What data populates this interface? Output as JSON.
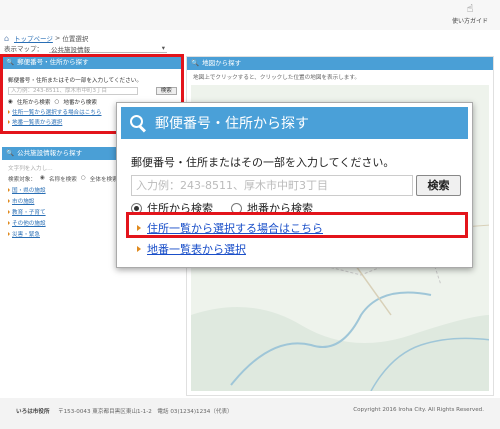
{
  "header": {
    "guide_label": "使い方ガイド",
    "guide_icon": "hand-pointer-icon"
  },
  "breadcrumb": {
    "home": "トップページ",
    "separator": ">",
    "current": "位置選択"
  },
  "map_select": {
    "label": "表示マップ：",
    "value": "公共施設情報"
  },
  "left_panel_postal": {
    "title": "郵便番号・住所から探す",
    "instruction": "郵便番号・住所またはその一部を入力してください。",
    "placeholder": "入力例：243-8511、厚木市中町3丁目",
    "search_label": "検索",
    "radio_address": "住所から検索",
    "radio_lot": "地番から検索",
    "link_address_list": "住所一覧から選択する場合はこちら",
    "link_lot_list": "地番一覧表から選択"
  },
  "left_panel_facility": {
    "title": "公共施設情報から探す",
    "hint": "文字列を入力し…",
    "search_method_label": "検索対象：",
    "radio_name": "名称を検索",
    "radio_all": "全体を検索",
    "categories": [
      "国・県の施設",
      "市の施設",
      "教育・子育て",
      "その他の施設",
      "災害・緊急"
    ]
  },
  "right_panel": {
    "title": "地図から探す",
    "note": "地図上でクリックすると、クリックした位置の地図を表示します。"
  },
  "popup": {
    "title": "郵便番号・住所から探す",
    "instruction": "郵便番号・住所またはその一部を入力してください。",
    "placeholder": "入力例：243-8511、厚木市中町3丁目",
    "search_label": "検索",
    "radio_address": "住所から検索",
    "radio_lot": "地番から検索",
    "link_address_list": "住所一覧から選択する場合はこちら",
    "link_lot_list": "地番一覧表から選択"
  },
  "footer": {
    "org": "いろは市役所",
    "address": "〒153-0043 東京都目黒区東山1-1-2　電話 03(1234)1234（代表）",
    "copyright": "Copyright 2016 Iroha City. All Rights Reserved."
  },
  "colors": {
    "accent": "#4aa0d8",
    "highlight": "#e3141b",
    "link": "#1a4fc9"
  }
}
